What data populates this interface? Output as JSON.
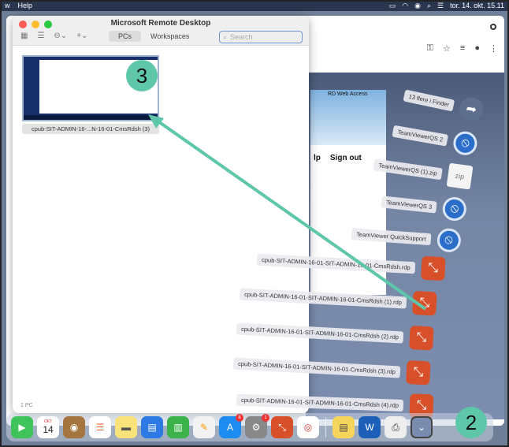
{
  "menubar": {
    "items": [
      "w",
      "Help"
    ],
    "datetime": "tor. 14. okt. 15.11"
  },
  "window": {
    "title": "Microsoft Remote Desktop",
    "tabs": [
      "PCs",
      "Workspaces"
    ],
    "search_placeholder": "Search",
    "pc_label": "cpub-SIT-ADMIN-16-...N-16-01-CmsRdsh (3)",
    "count": "1 PC"
  },
  "rdweb": {
    "title": "RD Web Access",
    "help": "lp",
    "signout": "Sign out"
  },
  "stack": {
    "items": [
      {
        "label": "13 flere i Finder",
        "icon": "arrow-icon"
      },
      {
        "label": "TeamViewerQS 2",
        "icon": "teamviewer-icon"
      },
      {
        "label": "TeamViewerQS (1).zip",
        "icon": "zip-icon"
      },
      {
        "label": "TeamViewerQS 3",
        "icon": "teamviewer-icon"
      },
      {
        "label": "TeamViewer QuickSupport",
        "icon": "teamviewer-icon"
      },
      {
        "label": "cpub-SIT-ADMIN-16-01-SIT-ADMIN-16-01-CmsRdsh.rdp",
        "icon": "rdp-icon"
      },
      {
        "label": "cpub-SIT-ADMIN-16-01-SIT-ADMIN-16-01-CmsRdsh (1).rdp",
        "icon": "rdp-icon"
      },
      {
        "label": "cpub-SIT-ADMIN-16-01-SIT-ADMIN-16-01-CmsRdsh (2).rdp",
        "icon": "rdp-icon"
      },
      {
        "label": "cpub-SIT-ADMIN-16-01-SIT-ADMIN-16-01-CmsRdsh (3).rdp",
        "icon": "rdp-icon"
      },
      {
        "label": "cpub-SIT-ADMIN-16-01-SIT-ADMIN-16-01-CmsRdsh (4).rdp",
        "icon": "rdp-icon"
      }
    ]
  },
  "dock": {
    "calendar_month": "OKT",
    "calendar_day": "14",
    "appstore_badge": "8",
    "settings_badge": "1"
  },
  "callouts": {
    "step2": "2",
    "step3": "3"
  },
  "colors": {
    "callout": "#5ec7a9",
    "rdp": "#d8502a",
    "teamviewer": "#2a6ec9"
  }
}
